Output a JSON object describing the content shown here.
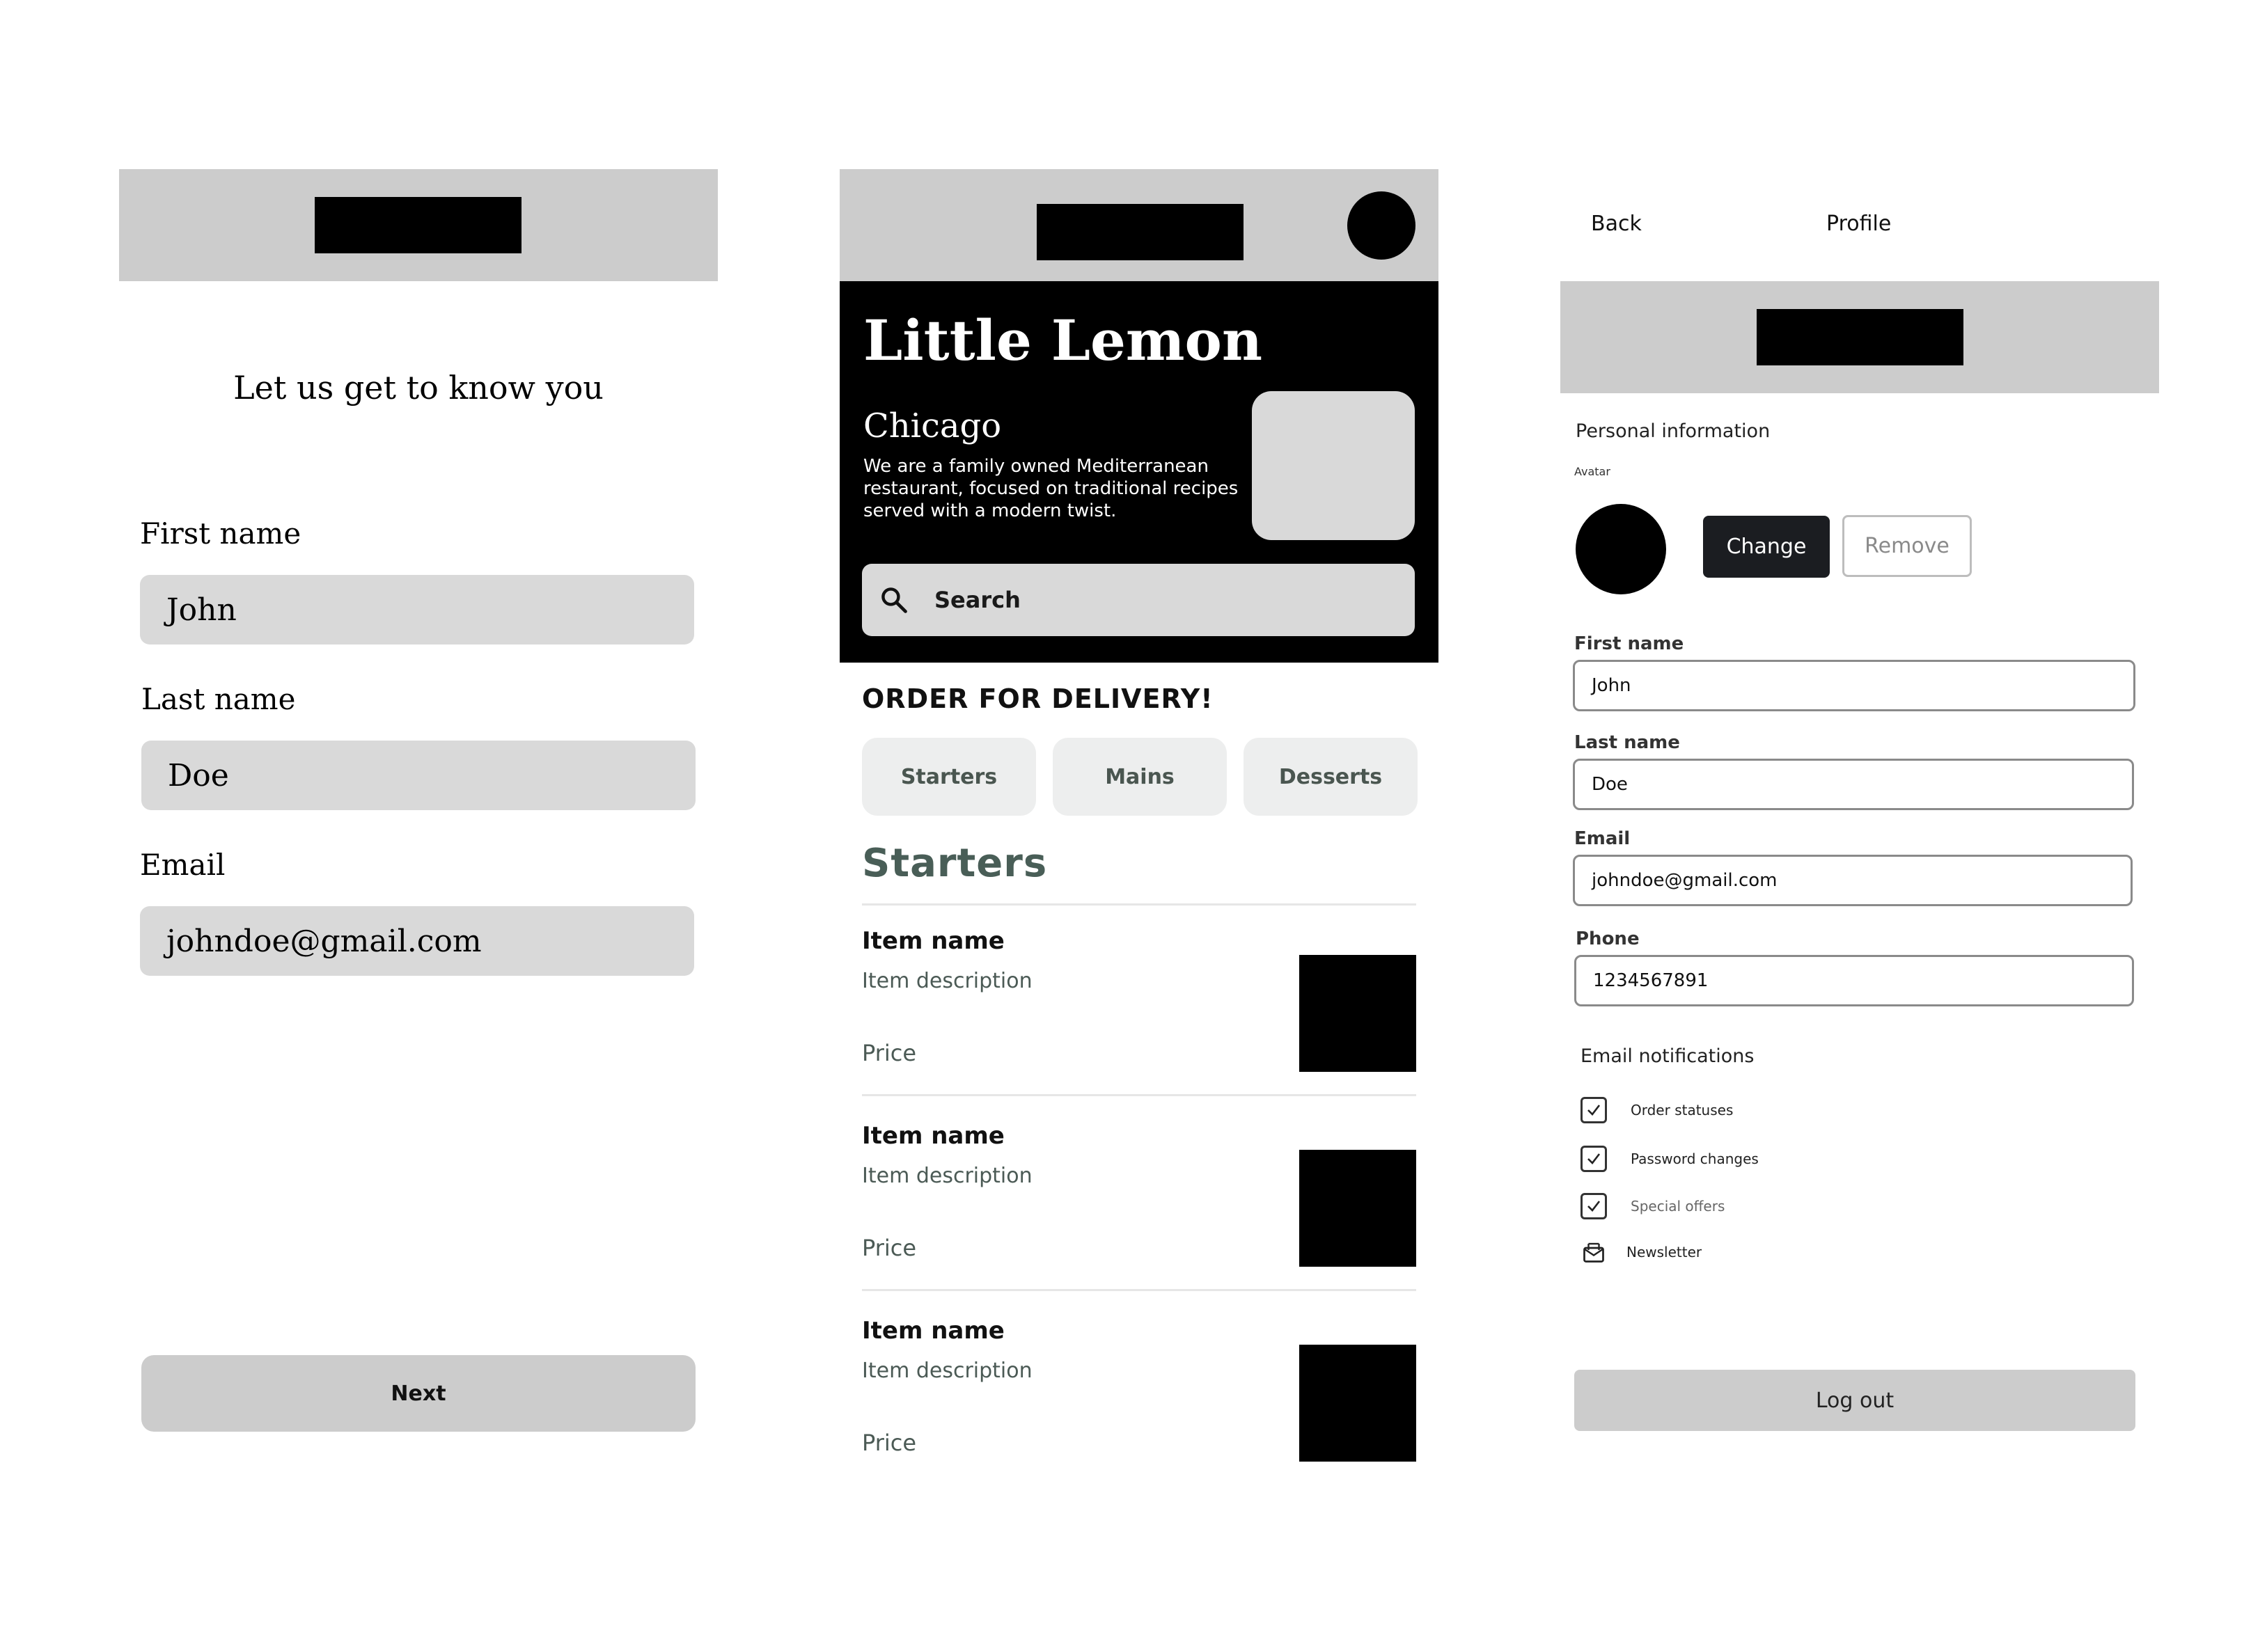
{
  "onboarding": {
    "title": "Let us get to know you",
    "first_name_label": "First name",
    "first_name_value": "John",
    "last_name_label": "Last name",
    "last_name_value": "Doe",
    "email_label": "Email",
    "email_value": "johndoe@gmail.com",
    "next_label": "Next"
  },
  "home": {
    "restaurant_name": "Little Lemon",
    "city": "Chicago",
    "description": "We are a family owned Mediterranean restaurant, focused on traditional recipes served with a modern twist.",
    "search_placeholder": "Search",
    "order_heading": "ORDER FOR DELIVERY!",
    "categories": [
      "Starters",
      "Mains",
      "Desserts"
    ],
    "section_title": "Starters",
    "menu_items": [
      {
        "name": "Item name",
        "description": "Item description",
        "price": "Price"
      },
      {
        "name": "Item name",
        "description": "Item description",
        "price": "Price"
      },
      {
        "name": "Item name",
        "description": "Item description",
        "price": "Price"
      }
    ]
  },
  "profile": {
    "back_label": "Back",
    "title": "Profile",
    "personal_info_heading": "Personal information",
    "avatar_label": "Avatar",
    "change_label": "Change",
    "remove_label": "Remove",
    "first_name_label": "First name",
    "first_name_value": "John",
    "last_name_label": "Last name",
    "last_name_value": "Doe",
    "email_label": "Email",
    "email_value": "johndoe@gmail.com",
    "phone_label": "Phone",
    "phone_value": "1234567891",
    "notifications_heading": "Email notifications",
    "notifications": [
      {
        "label": "Order statuses",
        "checked": true
      },
      {
        "label": "Password changes",
        "checked": true
      },
      {
        "label": "Special offers",
        "checked": true
      },
      {
        "label": "Newsletter",
        "checked": false
      }
    ],
    "logout_label": "Log out"
  },
  "icons": {
    "search": "search-icon",
    "check": "check-icon",
    "newsletter": "newsletter-icon"
  },
  "colors": {
    "header_gray": "#cccccc",
    "input_gray": "#d9d9d9",
    "category_bg": "#edeeee",
    "accent_green": "#495e57",
    "change_button": "#1b1d21"
  }
}
